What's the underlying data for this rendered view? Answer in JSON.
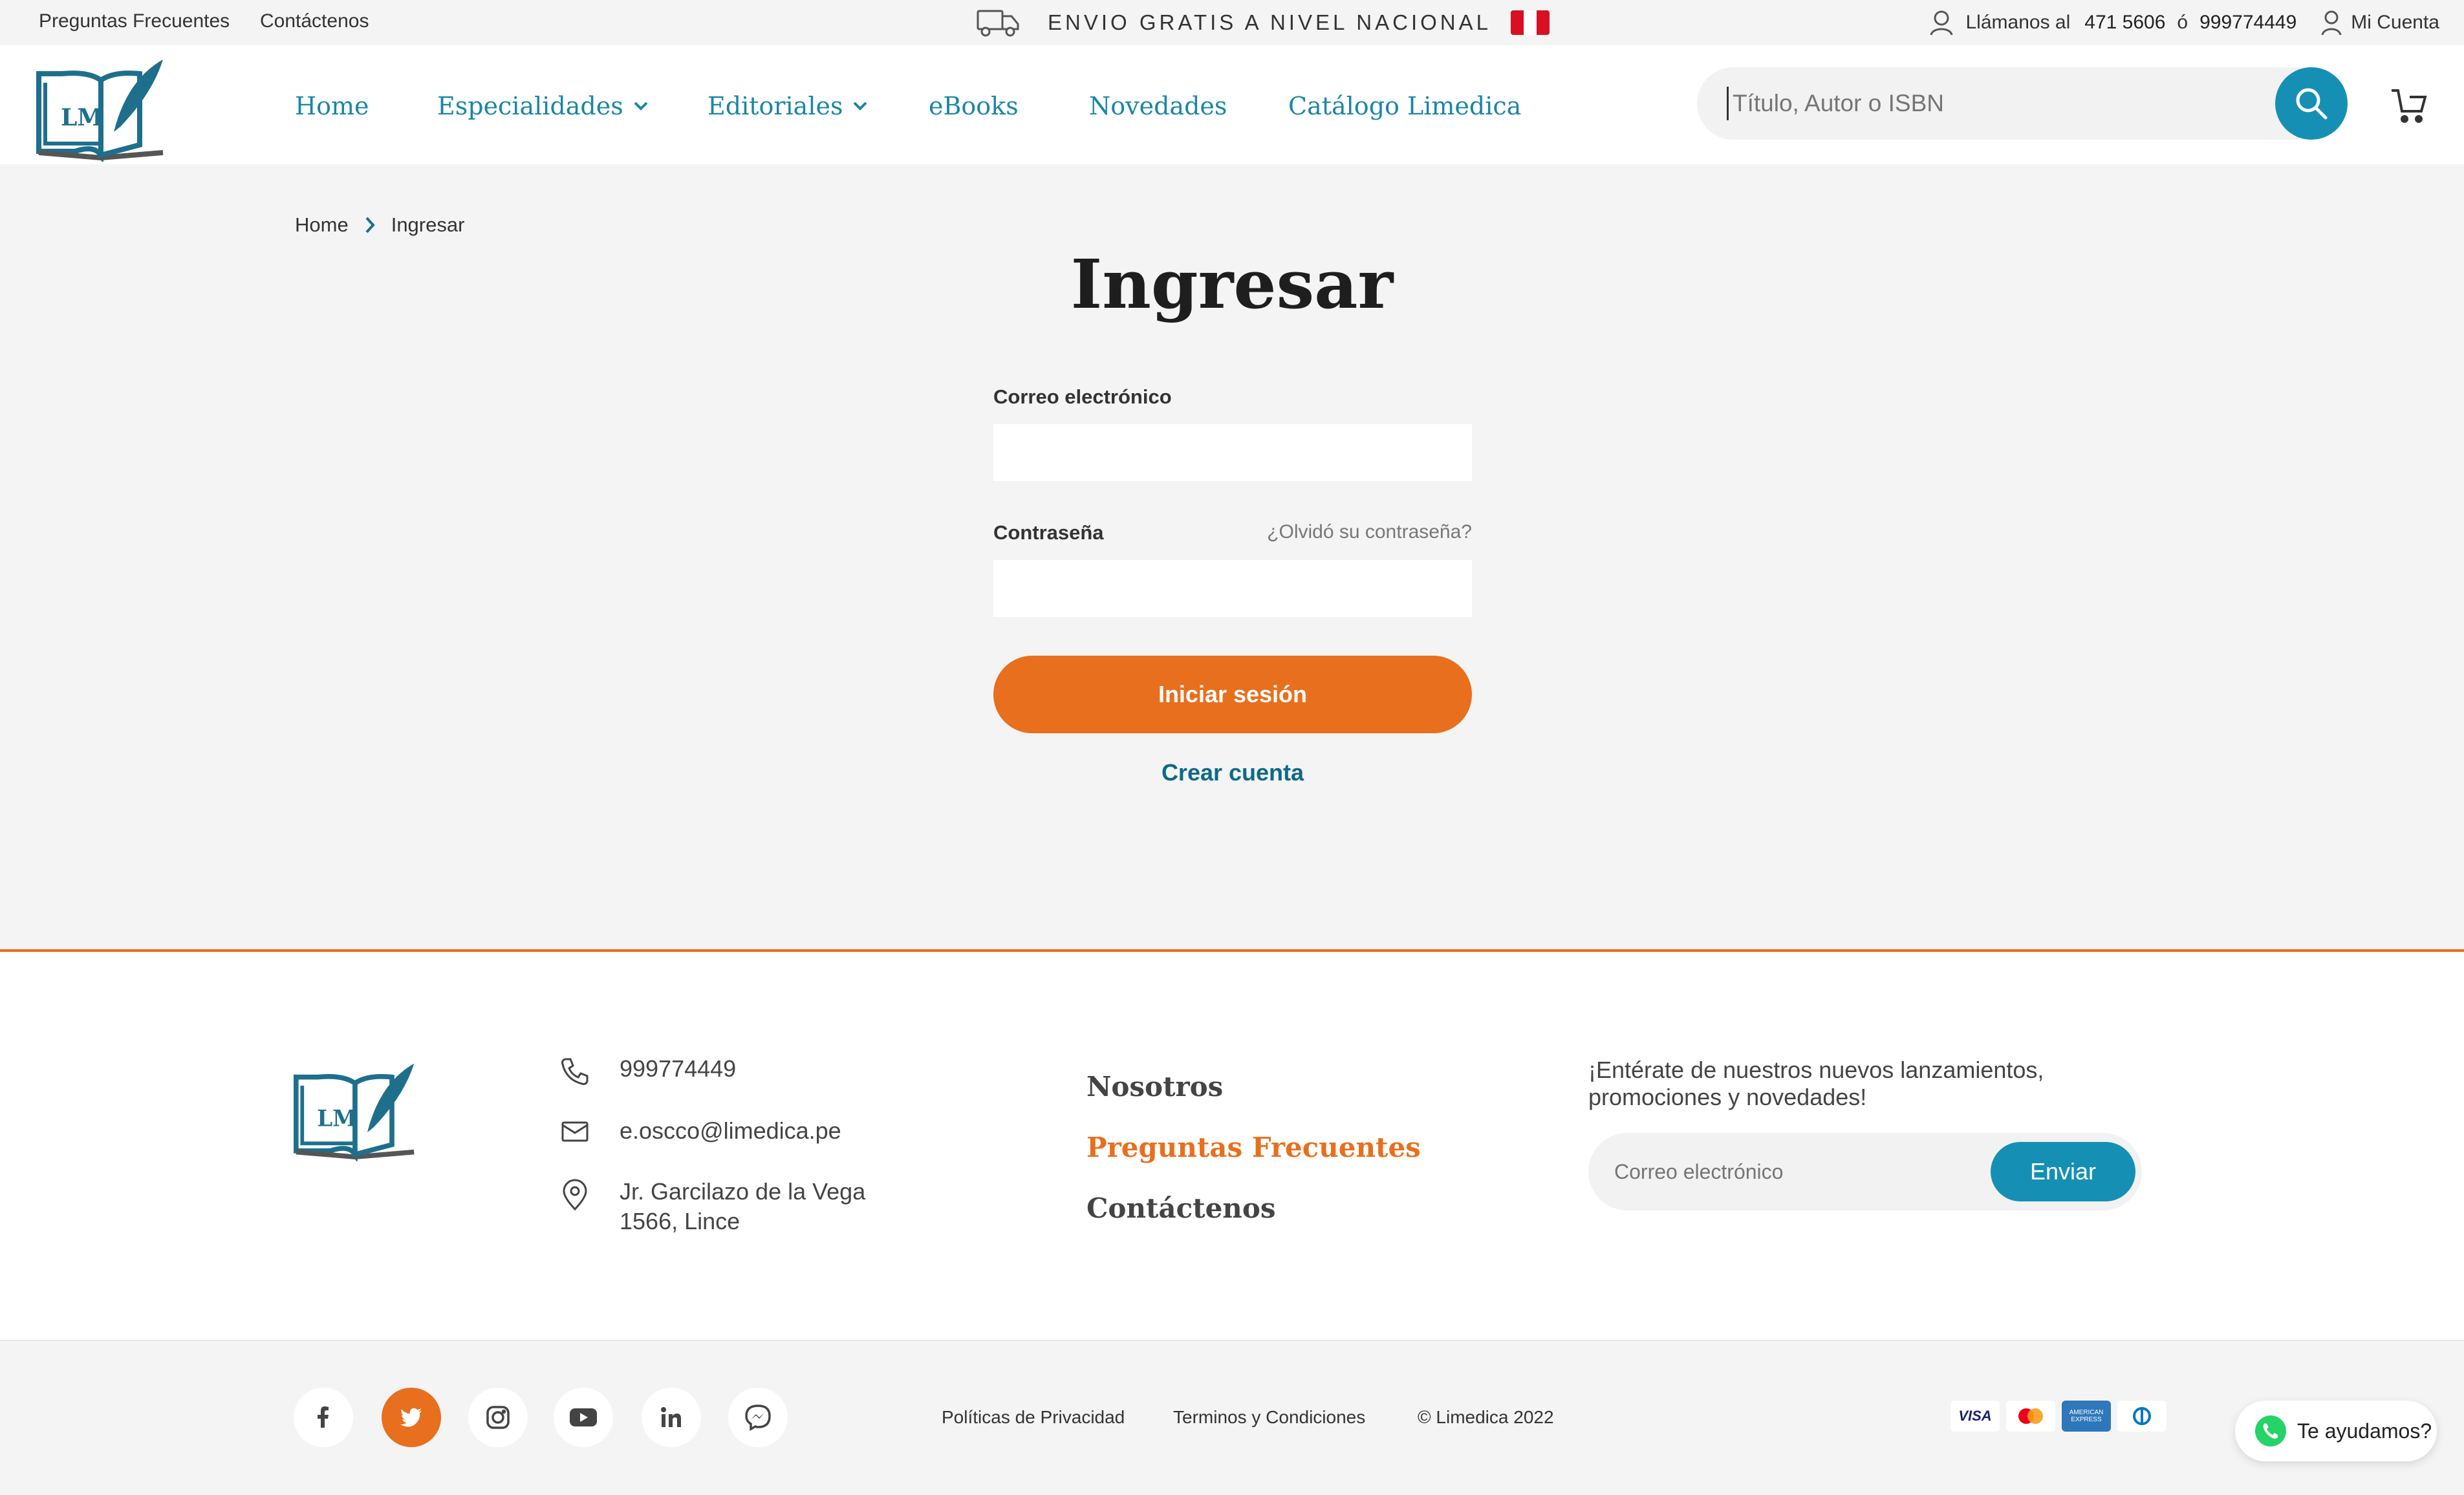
{
  "topbar": {
    "faq": "Preguntas Frecuentes",
    "contact": "Contáctenos",
    "promo": "ENVIO GRATIS A NIVEL NACIONAL",
    "call_label": "Llámanos al",
    "phone1": "471 5606",
    "or": "ó",
    "phone2": "999774449",
    "account": "Mi Cuenta"
  },
  "logo": {
    "text": "LM"
  },
  "nav": {
    "items": [
      {
        "label": "Home"
      },
      {
        "label": "Especialidades"
      },
      {
        "label": "Editoriales"
      },
      {
        "label": "eBooks"
      },
      {
        "label": "Novedades"
      },
      {
        "label": "Catálogo Limedica"
      }
    ]
  },
  "search": {
    "placeholder": "Título, Autor o ISBN"
  },
  "breadcrumb": {
    "home": "Home",
    "current": "Ingresar"
  },
  "login": {
    "title": "Ingresar",
    "email_label": "Correo electrónico",
    "password_label": "Contraseña",
    "forgot": "¿Olvidó su contraseña?",
    "submit": "Iniciar sesión",
    "create": "Crear cuenta"
  },
  "footer": {
    "phone": "999774449",
    "email": "e.oscco@limedica.pe",
    "address_line1": "Jr. Garcilazo de la Vega",
    "address_line2": "1566, Lince",
    "links": [
      "Nosotros",
      "Preguntas Frecuentes",
      "Contáctenos"
    ],
    "newsletter_line1": "¡Entérate de nuestros nuevos lanzamientos,",
    "newsletter_line2": "promociones y novedades!",
    "newsletter_placeholder": "Correo electrónico",
    "newsletter_button": "Enviar"
  },
  "bottom": {
    "privacy": "Políticas de Privacidad",
    "terms": "Terminos y Condiciones",
    "copyright": "© Limedica 2022",
    "payments": [
      "VISA",
      "mastercard",
      "AMERICAN EXPRESS",
      "diners"
    ],
    "help": "Te ayudamos?"
  },
  "colors": {
    "teal": "#1590b4",
    "orange": "#e86f1d",
    "dark_teal": "#0e6a86"
  }
}
